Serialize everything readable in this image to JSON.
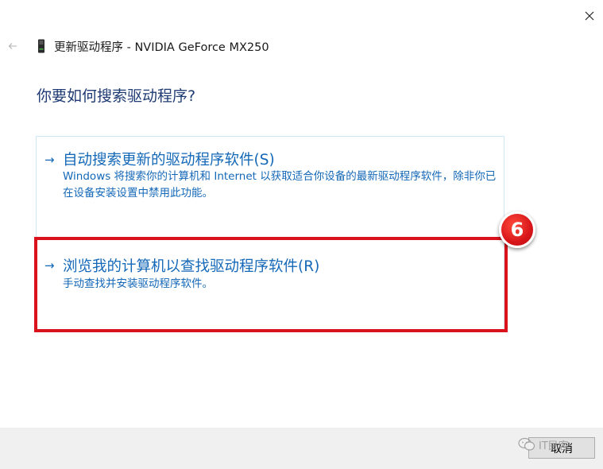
{
  "window": {
    "title": "更新驱动程序 - NVIDIA GeForce MX250",
    "close_icon": "close-icon",
    "back_icon": "back-arrow-icon",
    "device_icon": "graphics-card-icon"
  },
  "main": {
    "question": "你要如何搜索驱动程序?",
    "options": [
      {
        "arrow": "→",
        "title": "自动搜索更新的驱动程序软件(S)",
        "description": "Windows 将搜索你的计算机和 Internet 以获取适合你设备的最新驱动程序软件，除非你已在设备安装设置中禁用此功能。"
      },
      {
        "arrow": "→",
        "title": "浏览我的计算机以查找驱动程序软件(R)",
        "description": "手动查找并安装驱动程序软件。"
      }
    ],
    "step_badge": "6"
  },
  "footer": {
    "cancel_label": "取消",
    "watermark_text": "IT民客"
  },
  "colors": {
    "link_blue": "#1468b8",
    "heading_blue": "#1f3b74",
    "highlight_red": "#d9121c",
    "footer_bg": "#f0f0f0"
  }
}
